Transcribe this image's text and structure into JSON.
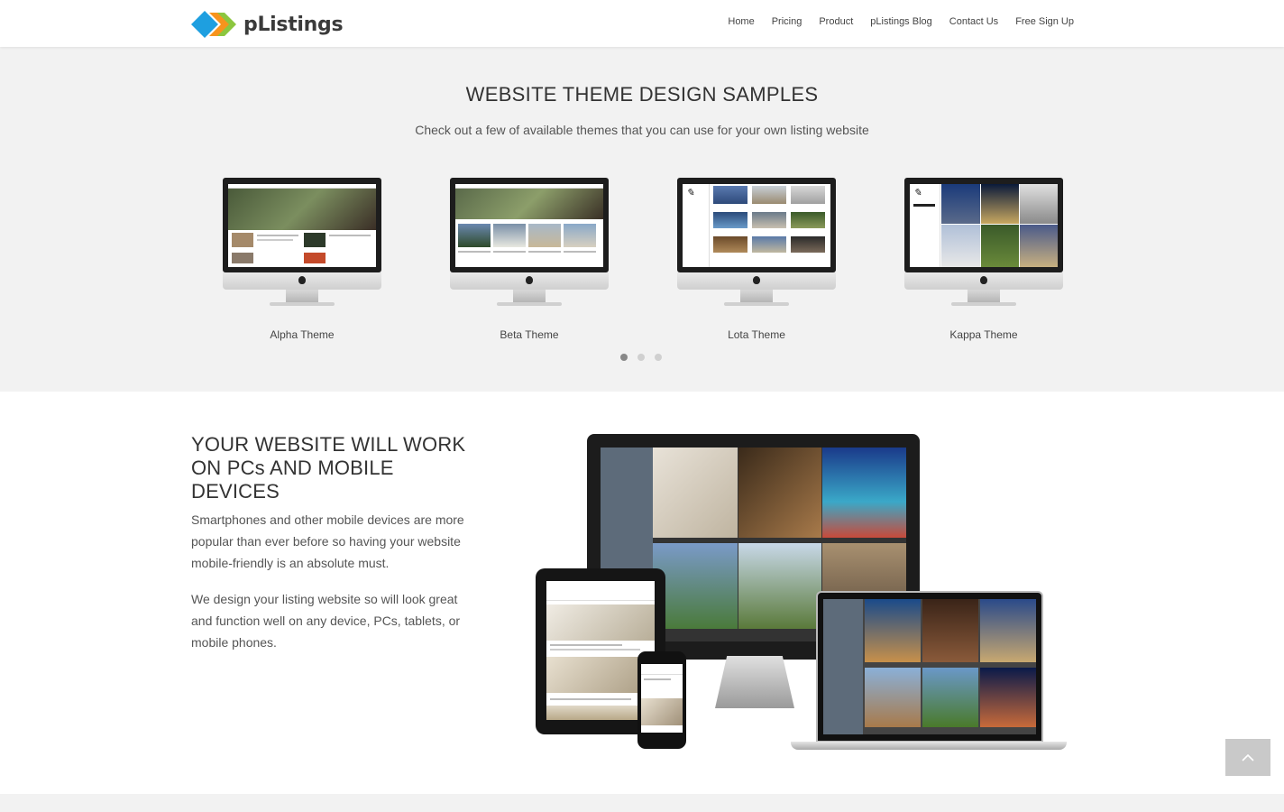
{
  "header": {
    "brand": "pListings",
    "nav": [
      {
        "label": "Home"
      },
      {
        "label": "Pricing"
      },
      {
        "label": "Product"
      },
      {
        "label": "pListings Blog"
      },
      {
        "label": "Contact Us"
      },
      {
        "label": "Free Sign Up"
      }
    ]
  },
  "themes": {
    "title": "WEBSITE THEME DESIGN SAMPLES",
    "subtitle": "Check out a few of available themes that you can use for your own listing website",
    "items": [
      {
        "label": "Alpha Theme"
      },
      {
        "label": "Beta Theme"
      },
      {
        "label": "Lota Theme"
      },
      {
        "label": "Kappa Theme"
      }
    ],
    "pagination": {
      "pages": 3,
      "active": 1
    }
  },
  "devices": {
    "title": "YOUR WEBSITE WILL WORK ON PCs AND MOBILE DEVICES",
    "para1": "Smartphones and other mobile devices are more popular than ever before so having your website mobile-friendly is an absolute must.",
    "para2": "We design your listing website so will look great and function well on any device, PCs, tablets, or mobile phones."
  },
  "colors": {
    "logo_blue": "#1e9fe0",
    "logo_green": "#8cc63f",
    "logo_orange": "#f7941d",
    "section_bg": "#f2f2f2"
  },
  "icons": {
    "back_to_top": "chevron-up-icon"
  }
}
